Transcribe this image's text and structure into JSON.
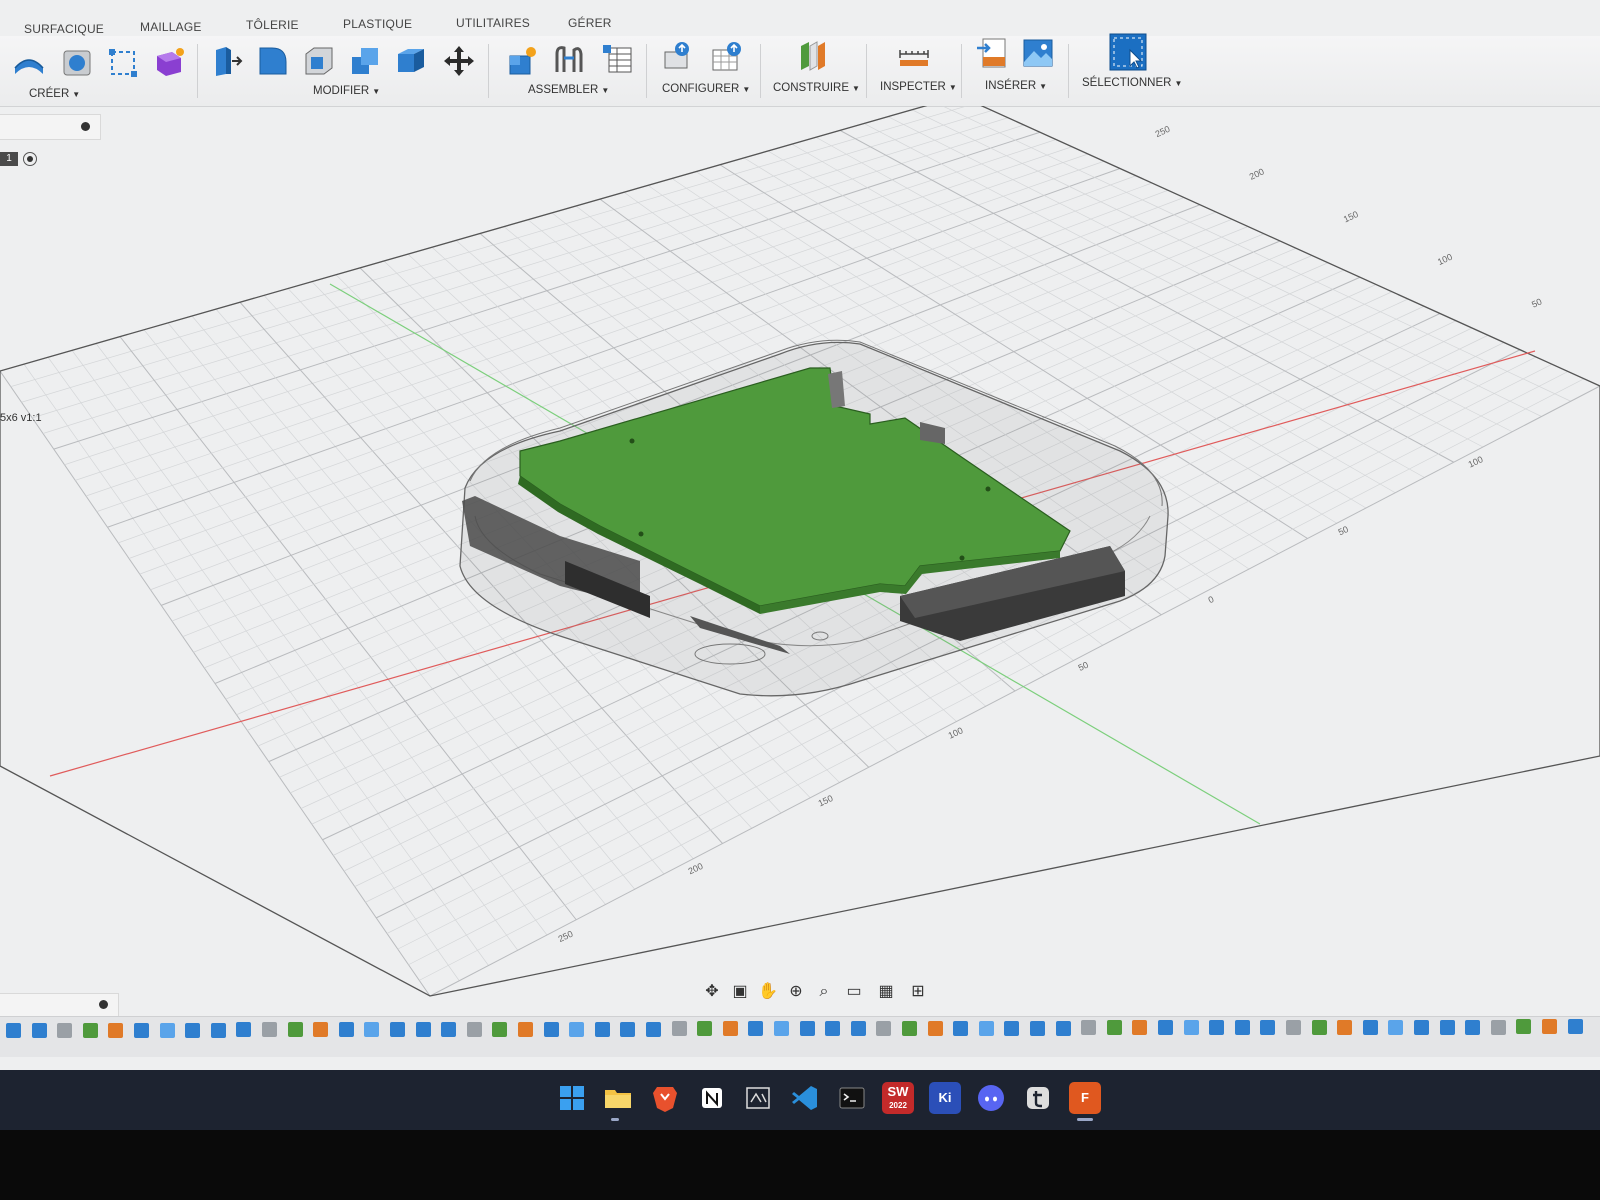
{
  "tabs": [
    "SURFACIQUE",
    "MAILLAGE",
    "TÔLERIE",
    "PLASTIQUE",
    "UTILITAIRES",
    "GÉRER"
  ],
  "groups": {
    "create": "CRÉER",
    "modify": "MODIFIER",
    "assemble": "ASSEMBLER",
    "configure": "CONFIGURER",
    "construct": "CONSTRUIRE",
    "inspect": "INSPECTER",
    "insert": "INSÉRER",
    "select": "SÉLECTIONNER"
  },
  "browser": {
    "component_tag": "1",
    "document_label": "5x6 v1:1"
  },
  "grid_scale_labels": [
    "250",
    "200",
    "150",
    "100",
    "50",
    "0",
    "100",
    "50",
    "0",
    "50",
    "100",
    "150",
    "200",
    "250"
  ],
  "taskbar": {
    "solidworks_label": "SW",
    "solidworks_year": "2022",
    "kicad_label": "Ki",
    "fusion_label": "F"
  },
  "colors": {
    "pcb": "#4f9a3c",
    "accent": "#1b6fc2",
    "taskbar": "#1d2330"
  }
}
